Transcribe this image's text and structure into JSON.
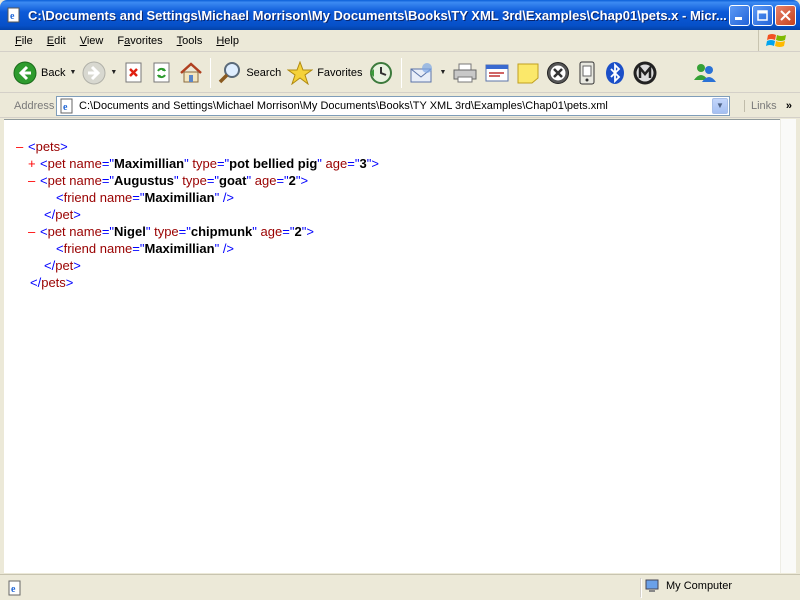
{
  "window": {
    "title": "C:\\Documents and Settings\\Michael Morrison\\My Documents\\Books\\TY XML 3rd\\Examples\\Chap01\\pets.x - Micr..."
  },
  "menu": {
    "items": [
      {
        "accel": "F",
        "rest": "ile"
      },
      {
        "accel": "E",
        "rest": "dit"
      },
      {
        "accel": "V",
        "rest": "iew"
      },
      {
        "accel": "",
        "pre": "F",
        "acc2": "a",
        "rest": "vorites"
      },
      {
        "accel": "T",
        "rest": "ools"
      },
      {
        "accel": "H",
        "rest": "elp"
      }
    ]
  },
  "toolbar": {
    "back_label": "Back",
    "search_label": "Search",
    "favorites_label": "Favorites"
  },
  "address": {
    "label": "Address",
    "value": "C:\\Documents and Settings\\Michael Morrison\\My Documents\\Books\\TY XML 3rd\\Examples\\Chap01\\pets.xml",
    "links_label": "Links"
  },
  "xml": {
    "root_tag": "pets",
    "pets": [
      {
        "toggle": "+",
        "name": "Maximillian",
        "type": "pot bellied pig",
        "age": "3",
        "friends": []
      },
      {
        "toggle": "-",
        "name": "Augustus",
        "type": "goat",
        "age": "2",
        "friends": [
          "Maximillian"
        ]
      },
      {
        "toggle": "-",
        "name": "Nigel",
        "type": "chipmunk",
        "age": "2",
        "friends": [
          "Maximillian"
        ]
      }
    ]
  },
  "status": {
    "zone_label": "My Computer"
  },
  "colors": {
    "titlebar": "#0a5fd8",
    "tag": "#990000",
    "bracket": "#0000ff",
    "toggle": "#ff0000"
  }
}
